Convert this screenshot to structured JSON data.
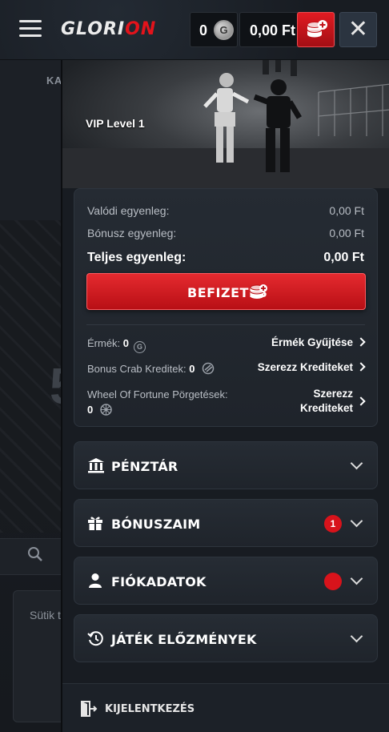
{
  "background": {
    "hero_label": "KA",
    "big_number": "5",
    "cookie_text": "Sütik továb megv"
  },
  "header": {
    "logo_left": "GLORI",
    "logo_right": "ON",
    "coins": "0",
    "coin_symbol": "G",
    "balance": "0,00 Ft"
  },
  "drawer": {
    "vip_level": "VIP Level 1",
    "balance": {
      "real_label": "Valódi egyenleg:",
      "real_value": "0,00 Ft",
      "bonus_label": "Bónusz egyenleg:",
      "bonus_value": "0,00 Ft",
      "total_label": "Teljes egyenleg:",
      "total_value": "0,00 Ft",
      "deposit_label": "BEFIZETÉS"
    },
    "coins_label": "Érmék:",
    "coins_value": "0",
    "coins_link": "Érmék Gyűjtése",
    "crab_label": "Bonus Crab Kreditek:",
    "crab_value": "0",
    "crab_link": "Szerezz Krediteket",
    "wheel_label": "Wheel Of Fortune Pörgetések:",
    "wheel_value": "0",
    "wheel_link_line1": "Szerezz",
    "wheel_link_line2": "Krediteket",
    "sections": {
      "cashier": "PÉNZTÁR",
      "bonuses": "BÓNUSZAIM",
      "bonuses_badge": "1",
      "account": "FIÓKADATOK",
      "history": "JÁTÉK ELŐZMÉNYEK"
    },
    "logout": "KIJELENTKEZÉS"
  },
  "colors": {
    "accent": "#e3131b",
    "panel": "#181c22",
    "card": "#252b33"
  }
}
